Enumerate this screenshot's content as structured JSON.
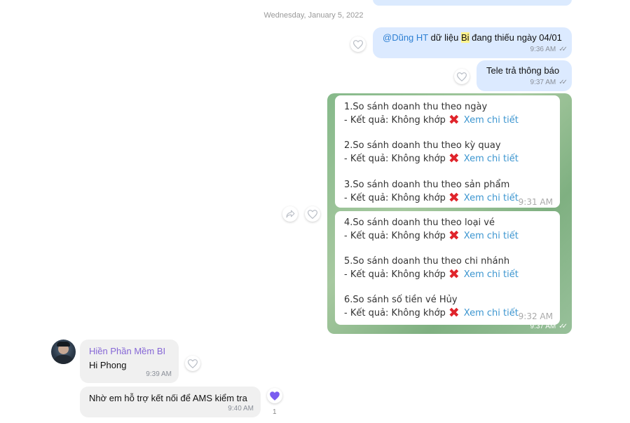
{
  "date_separator": "Wednesday, January 5, 2022",
  "messages": {
    "m1": {
      "mention": "@Dũng HT",
      "text_before": " dữ liệu ",
      "highlight": "Bi",
      "text_after": " đang thiếu ngày 04/01",
      "time": "9:36 AM"
    },
    "m2": {
      "text": "Tele trả thông báo",
      "time": "9:37 AM"
    },
    "image": {
      "time": "9:37 AM",
      "card1": {
        "items": [
          {
            "title": "1.So sánh doanh thu theo ngày",
            "result": "- Kết quả: Không khớp",
            "link": "Xem chi tiết"
          },
          {
            "title": "2.So sánh doanh thu theo kỳ quay",
            "result": "- Kết quả: Không khớp",
            "link": "Xem chi tiết"
          },
          {
            "title": "3.So sánh doanh thu theo sản phẩm",
            "result": "- Kết quả: Không khớp",
            "link": "Xem chi tiết"
          }
        ],
        "time": "9:31 AM"
      },
      "card2": {
        "items": [
          {
            "title": "4.So sánh doanh thu theo loại vé",
            "result": "- Kết quả: Không khớp",
            "link": "Xem chi tiết"
          },
          {
            "title": "5.So sánh doanh thu theo chi nhánh",
            "result": "- Kết quả: Không khớp",
            "link": "Xem chi tiết"
          },
          {
            "title": "6.So sánh số tiền vé Hủy",
            "result": "- Kết quả: Không khớp",
            "link": "Xem chi tiết"
          }
        ],
        "time": "9:32 AM"
      }
    },
    "m3": {
      "sender": "Hiền Phần Mềm BI",
      "text": "Hi Phong",
      "time": "9:39 AM"
    },
    "m4": {
      "text": "Nhờ em hỗ trợ kết nối để AMS kiểm tra",
      "time": "9:40 AM",
      "reaction_count": "1"
    }
  },
  "icons": {
    "heart": "heart-outline-icon",
    "heart_filled": "heart-filled-icon",
    "share": "share-icon",
    "x_mark": "cross-mark-icon",
    "read_ticks": "double-check-icon"
  },
  "colors": {
    "outgoing_bubble": "#dceaff",
    "incoming_bubble": "#f0f0f0",
    "mention": "#2d7fd3",
    "sender_name": "#8667d6",
    "link": "#3d96d0",
    "x_mark": "#e0242b",
    "reaction": "#7a5cf0"
  }
}
